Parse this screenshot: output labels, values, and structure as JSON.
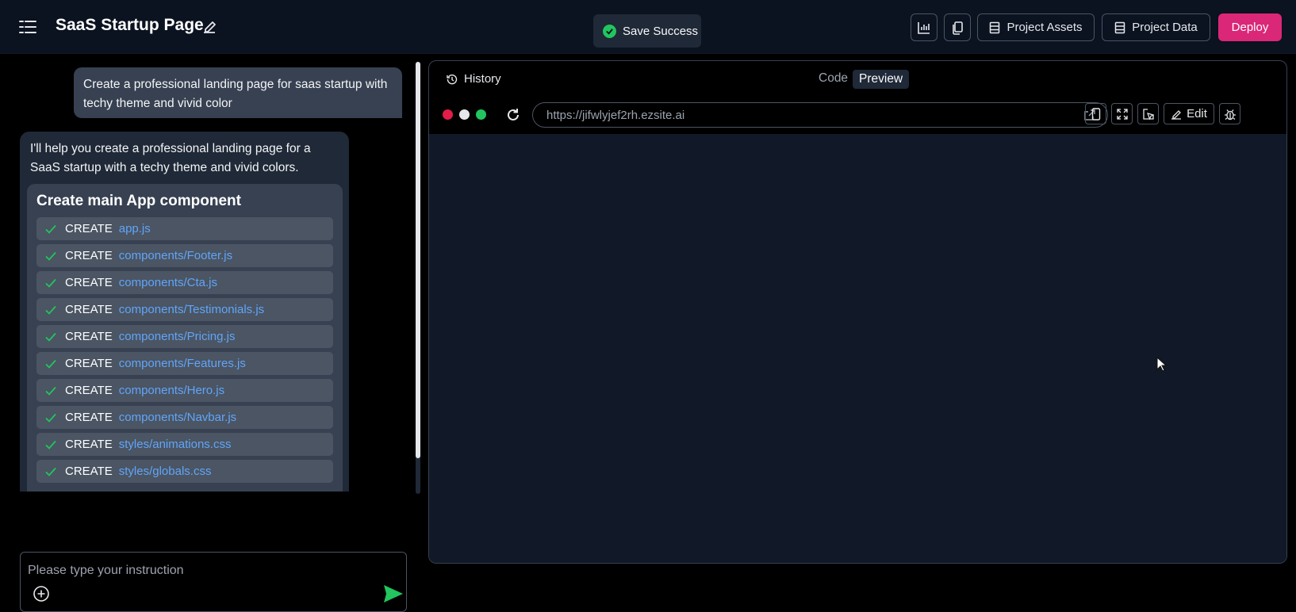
{
  "header": {
    "title": "SaaS Startup Page",
    "toast": "Save Success",
    "buttons": {
      "project_assets": "Project Assets",
      "project_data": "Project Data",
      "deploy": "Deploy"
    }
  },
  "chat": {
    "user_message": "Create a professional landing page for saas startup with techy theme and vivid color",
    "ai_message": "I'll help you create a professional landing page for a SaaS startup with a techy theme and vivid colors.",
    "task": {
      "title": "Create main App component",
      "files": [
        {
          "op": "CREATE",
          "path": "app.js"
        },
        {
          "op": "CREATE",
          "path": "components/Footer.js"
        },
        {
          "op": "CREATE",
          "path": "components/Cta.js"
        },
        {
          "op": "CREATE",
          "path": "components/Testimonials.js"
        },
        {
          "op": "CREATE",
          "path": "components/Pricing.js"
        },
        {
          "op": "CREATE",
          "path": "components/Features.js"
        },
        {
          "op": "CREATE",
          "path": "components/Hero.js"
        },
        {
          "op": "CREATE",
          "path": "components/Navbar.js"
        },
        {
          "op": "CREATE",
          "path": "styles/animations.css"
        },
        {
          "op": "CREATE",
          "path": "styles/globals.css"
        }
      ]
    },
    "composer": {
      "placeholder": "Please type your instruction",
      "value": ""
    }
  },
  "preview": {
    "history_label": "History",
    "tabs": {
      "code": "Code",
      "preview": "Preview",
      "active": "Preview"
    },
    "url": "https://jifwlyjef2rh.ezsite.ai",
    "edit_label": "Edit"
  },
  "colors": {
    "accent": "#db2777",
    "success": "#22c55e",
    "link": "#60a5fa",
    "dot_red": "#e11d48",
    "dot_white": "#e5e7eb",
    "dot_green": "#22c55e"
  }
}
